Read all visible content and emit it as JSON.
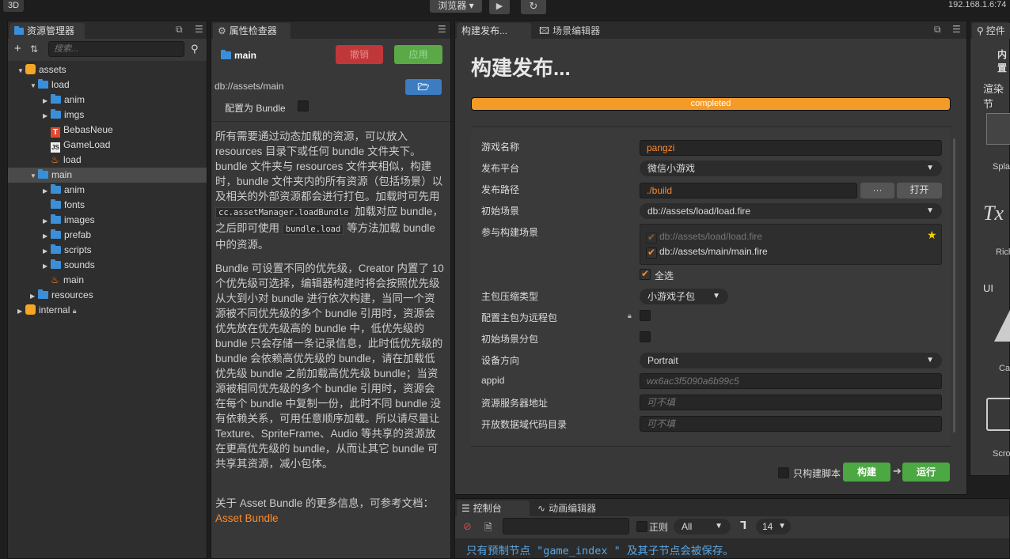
{
  "topbar": {
    "mode_3d": "3D",
    "browser_label": "浏览器",
    "play_icon": "play-icon",
    "refresh_icon": "refresh-icon",
    "ip": "192.168.1.6:74"
  },
  "assets": {
    "tab": "资源管理器",
    "search_placeholder": "搜索...",
    "tree": [
      {
        "label": "assets",
        "icon": "db-icon"
      },
      {
        "label": "load",
        "icon": "folder-icon"
      },
      {
        "label": "anim",
        "icon": "folder-icon"
      },
      {
        "label": "imgs",
        "icon": "folder-icon"
      },
      {
        "label": "BebasNeue",
        "icon": "font-icon"
      },
      {
        "label": "GameLoad",
        "icon": "js-icon"
      },
      {
        "label": "load",
        "icon": "fire-icon"
      },
      {
        "label": "main",
        "icon": "folder-icon"
      },
      {
        "label": "anim",
        "icon": "folder-icon"
      },
      {
        "label": "fonts",
        "icon": "folder-icon"
      },
      {
        "label": "images",
        "icon": "folder-icon"
      },
      {
        "label": "prefab",
        "icon": "folder-icon"
      },
      {
        "label": "scripts",
        "icon": "folder-icon"
      },
      {
        "label": "sounds",
        "icon": "folder-icon"
      },
      {
        "label": "main",
        "icon": "fire-icon"
      },
      {
        "label": "resources",
        "icon": "folder-icon"
      },
      {
        "label": "internal",
        "icon": "db-icon"
      }
    ]
  },
  "inspector": {
    "tab": "属性检查器",
    "name": "main",
    "revert": "撤销",
    "apply": "应用",
    "path": "db://assets/main",
    "bundle_label": "配置为 Bundle",
    "p1a": "所有需要通过动态加载的资源，可以放入 resources 目录下或任何 bundle 文件夹下。bundle 文件夹与 resources 文件夹相似，构建时，bundle 文件夹内的所有资源（包括场景）以及相关的外部资源都会进行打包。加载时可先用",
    "p1code1": "cc.assetManager.loadBundle",
    "p1b": "加载对应 bundle，之后即可使用",
    "p1code2": "bundle.load",
    "p1c": "等方法加载 bundle 中的资源。",
    "p2": "Bundle 可设置不同的优先级，Creator 内置了 10 个优先级可选择，编辑器构建时将会按照优先级从大到小对 bundle 进行依次构建，当同一个资源被不同优先级的多个 bundle 引用时，资源会优先放在优先级高的 bundle 中，低优先级的 bundle 只会存储一条记录信息，此时低优先级的 bundle 会依赖高优先级的 bundle，请在加载低优先级 bundle 之前加载高优先级 bundle；当资源被相同优先级的多个 bundle 引用时，资源会在每个 bundle 中复制一份，此时不同 bundle 没有依赖关系，可用任意顺序加载。所以请尽量让 Texture、SpriteFrame、Audio 等共享的资源放在更高优先级的 bundle，从而让其它 bundle 可共享其资源，减小包体。",
    "p3": "关于 Asset Bundle 的更多信息，可参考文档：",
    "p3link": "Asset Bundle"
  },
  "build": {
    "tab": "构建发布...",
    "tab2": "场景编辑器",
    "title": "构建发布...",
    "progress_text": "completed",
    "progress": 1.0,
    "game_name_label": "游戏名称",
    "game_name": "pangzi",
    "platform_label": "发布平台",
    "platform": "微信小游戏",
    "path_label": "发布路径",
    "path": "./build",
    "path_more": "···",
    "path_open": "打开",
    "start_scene_label": "初始场景",
    "start_scene": "db://assets/load/load.fire",
    "scenes_label": "参与构建场景",
    "scenes": [
      "db://assets/load/load.fire",
      "db://assets/main/main.fire"
    ],
    "select_all": "全选",
    "compress_label": "主包压缩类型",
    "compress": "小游戏子包",
    "remote_label": "配置主包为远程包",
    "start_subpkg_label": "初始场景分包",
    "orientation_label": "设备方向",
    "orientation": "Portrait",
    "appid_label": "appid",
    "appid": "wx6ac3f5090a6b99c5",
    "server_label": "资源服务器地址",
    "server_placeholder": "可不填",
    "open_data_label": "开放数据域代码目录",
    "open_data_placeholder": "可不填",
    "only_script": "只构建脚本",
    "build_btn": "构建",
    "run_btn": "运行"
  },
  "controls": {
    "tab": "控件",
    "t1": "内置",
    "t2": "渲染节",
    "t3": "Spla",
    "t4": "Rich",
    "t5": "UI",
    "t6": "Ca",
    "t7": "Scro"
  },
  "console": {
    "tab": "控制台",
    "tab2": "动画编辑器",
    "regex_label": "正则",
    "level": "All",
    "font_size": "14",
    "message": "只有预制节点 \"game_index \" 及其子节点会被保存。"
  },
  "colors": {
    "orange": "#ff8a2a",
    "revert": "#c0373a",
    "apply": "#5aa946",
    "build": "#4ca842",
    "link": "#ff8a2a"
  }
}
